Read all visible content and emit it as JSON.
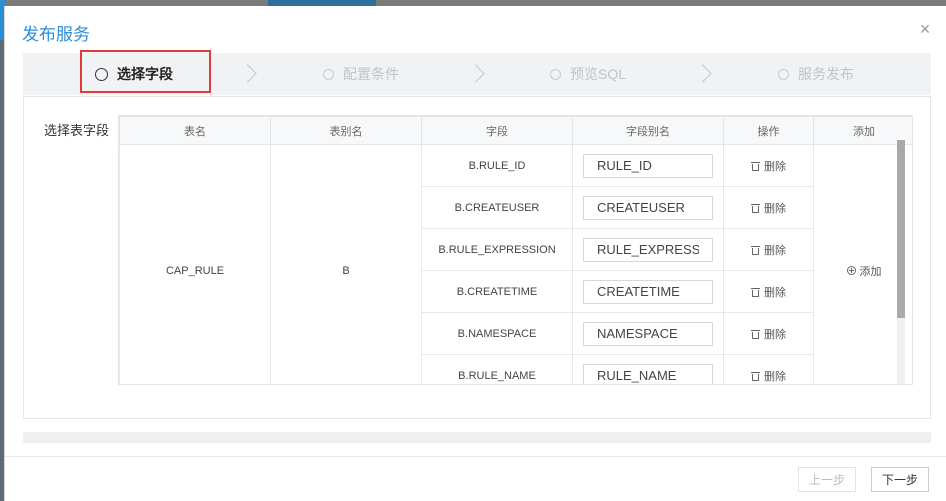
{
  "dialog": {
    "title": "发布服务",
    "close_icon": "close-icon"
  },
  "steps": [
    {
      "label": "选择字段",
      "active": true
    },
    {
      "label": "配置条件",
      "active": false
    },
    {
      "label": "预览SQL",
      "active": false
    },
    {
      "label": "服务发布",
      "active": false
    }
  ],
  "panel": {
    "label": "选择表字段",
    "columns": [
      "表名",
      "表别名",
      "字段",
      "字段别名",
      "操作",
      "添加"
    ],
    "table_name": "CAP_RULE",
    "table_alias": "B",
    "rows": [
      {
        "field": "B.RULE_ID",
        "alias": "RULE_ID",
        "op": "删除"
      },
      {
        "field": "B.CREATEUSER",
        "alias": "CREATEUSER",
        "op": "删除"
      },
      {
        "field": "B.RULE_EXPRESSION",
        "alias": "RULE_EXPRESS",
        "op": "删除"
      },
      {
        "field": "B.CREATETIME",
        "alias": "CREATETIME",
        "op": "删除"
      },
      {
        "field": "B.NAMESPACE",
        "alias": "NAMESPACE",
        "op": "删除"
      },
      {
        "field": "B.RULE_NAME",
        "alias": "RULE_NAME",
        "op": "删除"
      }
    ],
    "add_label": "添加"
  },
  "footer": {
    "prev_label": "上一步",
    "next_label": "下一步"
  },
  "colors": {
    "accent": "#2a8fd6",
    "highlight": "#e03b3b"
  }
}
